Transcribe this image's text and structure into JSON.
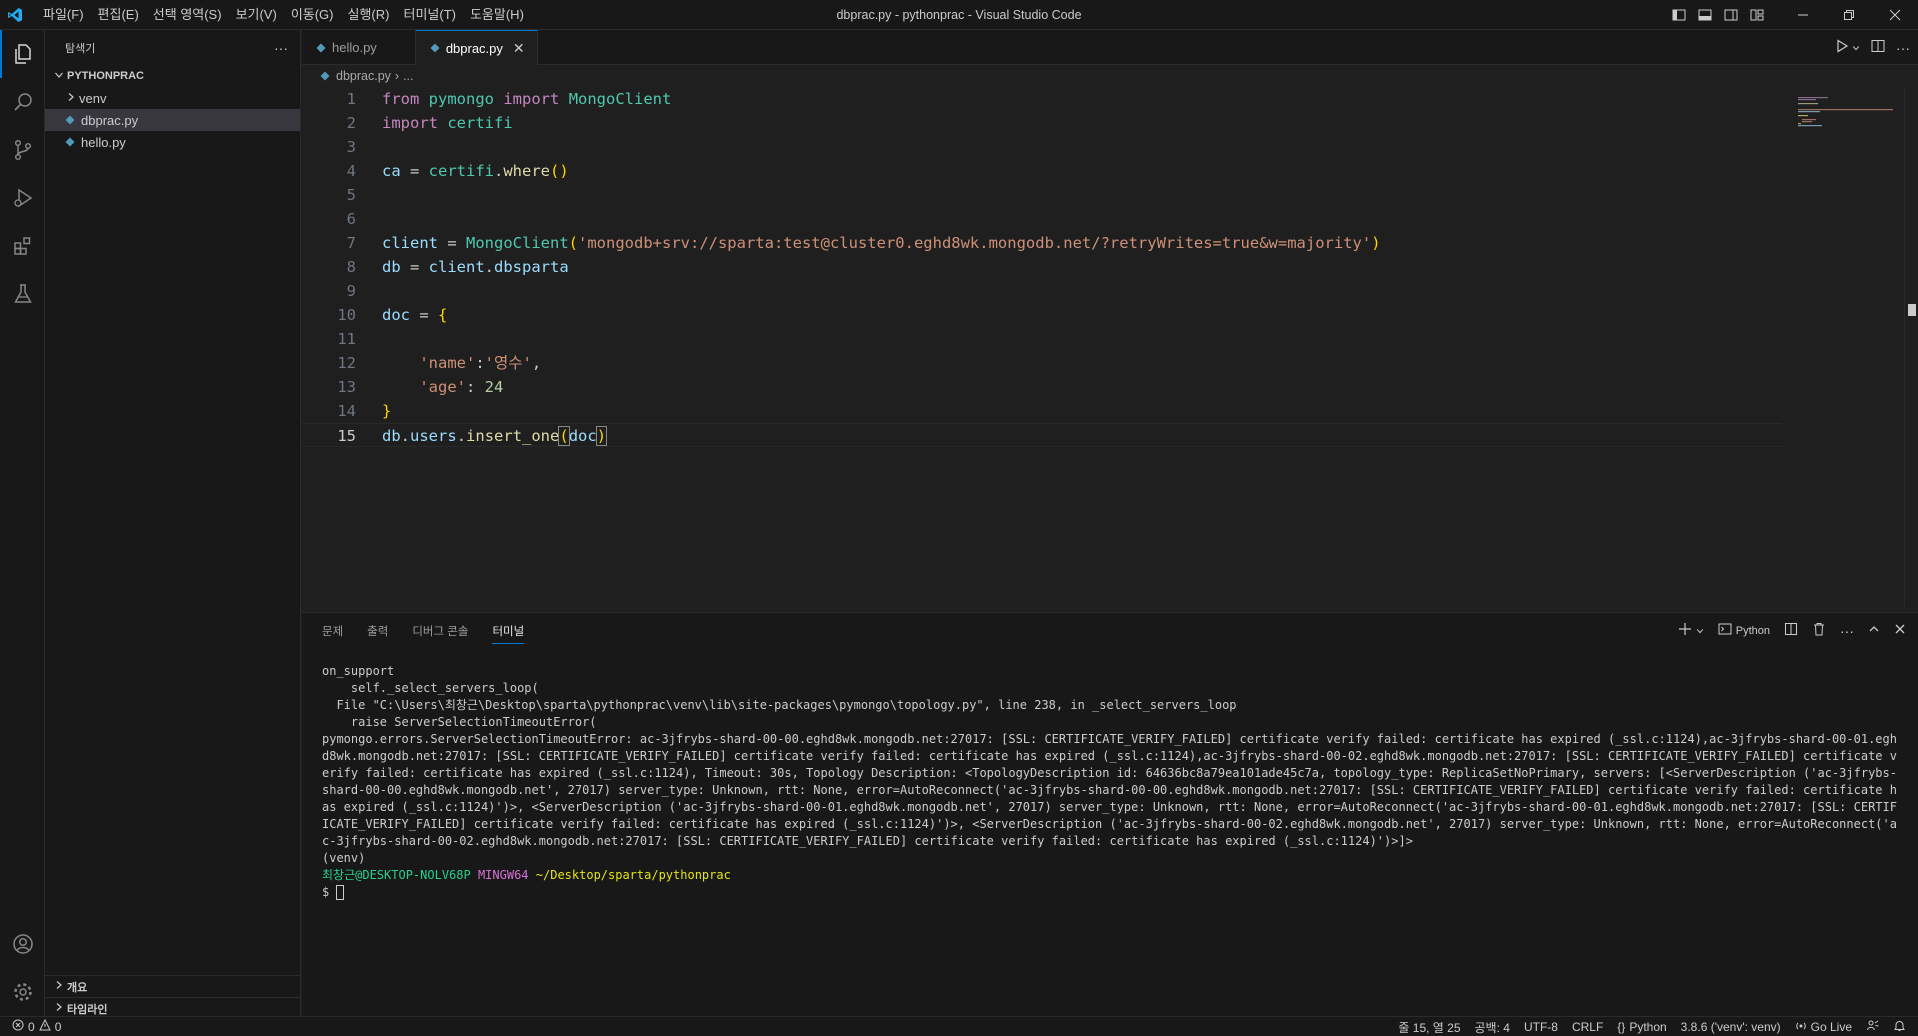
{
  "titlebar": {
    "menu": [
      "파일(F)",
      "편집(E)",
      "선택 영역(S)",
      "보기(V)",
      "이동(G)",
      "실행(R)",
      "터미널(T)",
      "도움말(H)"
    ],
    "window_title": "dbprac.py - pythonprac - Visual Studio Code"
  },
  "sidebar": {
    "title": "탐색기",
    "more": "···",
    "folder": "PYTHONPRAC",
    "items": [
      {
        "label": "venv"
      },
      {
        "label": "dbprac.py"
      },
      {
        "label": "hello.py"
      }
    ],
    "outline": "개요",
    "timeline": "타임라인"
  },
  "editor": {
    "tabs": [
      {
        "label": "hello.py"
      },
      {
        "label": "dbprac.py",
        "close": "✕"
      }
    ],
    "breadcrumb": {
      "file": "dbprac.py",
      "sep": "›",
      "more": "..."
    },
    "line_numbers": [
      "1",
      "2",
      "3",
      "4",
      "5",
      "6",
      "7",
      "8",
      "9",
      "10",
      "11",
      "12",
      "13",
      "14",
      "15"
    ],
    "code": {
      "l1": {
        "kw1": "from",
        "mod": "pymongo",
        "kw2": "import",
        "cls": "MongoClient"
      },
      "l2": {
        "kw": "import",
        "mod": "certifi"
      },
      "l4": {
        "var": "ca",
        "op": " = ",
        "mod": "certifi",
        "dot": ".",
        "fn": "where",
        "paren": "()"
      },
      "l7": {
        "var": "client",
        "op": " = ",
        "cls": "MongoClient",
        "open": "(",
        "str": "'mongodb+srv://sparta:test@cluster0.eghd8wk.mongodb.net/?retryWrites=true&w=majority'",
        "close": ")"
      },
      "l8": {
        "var": "db",
        "op": " = ",
        "obj": "client",
        "dot": ".",
        "attr": "dbsparta"
      },
      "l10": {
        "var": "doc",
        "op": " = ",
        "brace": "{"
      },
      "l12": {
        "key": "'name'",
        "colon": ":",
        "val": "'영수'",
        "comma": ","
      },
      "l13": {
        "key": "'age'",
        "colon": ": ",
        "val": "24"
      },
      "l14": {
        "brace": "}"
      },
      "l15": {
        "obj": "db",
        "d1": ".",
        "attr": "users",
        "d2": ".",
        "fn": "insert_one",
        "open": "(",
        "arg": "doc",
        "close": ")"
      }
    }
  },
  "panel": {
    "tabs": [
      "문제",
      "출력",
      "디버그 콘솔",
      "터미널"
    ],
    "shell_label": "Python",
    "terminal": {
      "lines": [
        "on_support",
        "    self._select_servers_loop(",
        "  File \"C:\\Users\\최창근\\Desktop\\sparta\\pythonprac\\venv\\lib\\site-packages\\pymongo\\topology.py\", line 238, in _select_servers_loop",
        "    raise ServerSelectionTimeoutError("
      ],
      "error": "pymongo.errors.ServerSelectionTimeoutError: ac-3jfrybs-shard-00-00.eghd8wk.mongodb.net:27017: [SSL: CERTIFICATE_VERIFY_FAILED] certificate verify failed: certificate has expired (_ssl.c:1124),ac-3jfrybs-shard-00-01.eghd8wk.mongodb.net:27017: [SSL: CERTIFICATE_VERIFY_FAILED] certificate verify failed: certificate has expired (_ssl.c:1124),ac-3jfrybs-shard-00-02.eghd8wk.mongodb.net:27017: [SSL: CERTIFICATE_VERIFY_FAILED] certificate verify failed: certificate has expired (_ssl.c:1124), Timeout: 30s, Topology Description: <TopologyDescription id: 64636bc8a79ea101ade45c7a, topology_type: ReplicaSetNoPrimary, servers: [<ServerDescription ('ac-3jfrybs-shard-00-00.eghd8wk.mongodb.net', 27017) server_type: Unknown, rtt: None, error=AutoReconnect('ac-3jfrybs-shard-00-00.eghd8wk.mongodb.net:27017: [SSL: CERTIFICATE_VERIFY_FAILED] certificate verify failed: certificate has expired (_ssl.c:1124)')>, <ServerDescription ('ac-3jfrybs-shard-00-01.eghd8wk.mongodb.net', 27017) server_type: Unknown, rtt: None, error=AutoReconnect('ac-3jfrybs-shard-00-01.eghd8wk.mongodb.net:27017: [SSL: CERTIFICATE_VERIFY_FAILED] certificate verify failed: certificate has expired (_ssl.c:1124)')>, <ServerDescription ('ac-3jfrybs-shard-00-02.eghd8wk.mongodb.net', 27017) server_type: Unknown, rtt: None, error=AutoReconnect('ac-3jfrybs-shard-00-02.eghd8wk.mongodb.net:27017: [SSL: CERTIFICATE_VERIFY_FAILED] certificate verify failed: certificate has expired (_ssl.c:1124)')>]>",
      "venv": "(venv)",
      "prompt_user": "최창근@DESKTOP-NOLV68P",
      "prompt_env": "MINGW64",
      "prompt_path": "~/Desktop/sparta/pythonprac",
      "prompt_symbol": "$ "
    }
  },
  "statusbar": {
    "errors": "0",
    "warnings": "0",
    "position": "줄 15, 열 25",
    "spaces": "공백: 4",
    "encoding": "UTF-8",
    "eol": "CRLF",
    "language": "Python",
    "interpreter": "3.8.6 ('venv': venv)",
    "golive": "Go Live"
  },
  "colors": {
    "accent": "#0078d4",
    "python_icon": "#519aba",
    "vscode_logo": "#23a9f2"
  }
}
